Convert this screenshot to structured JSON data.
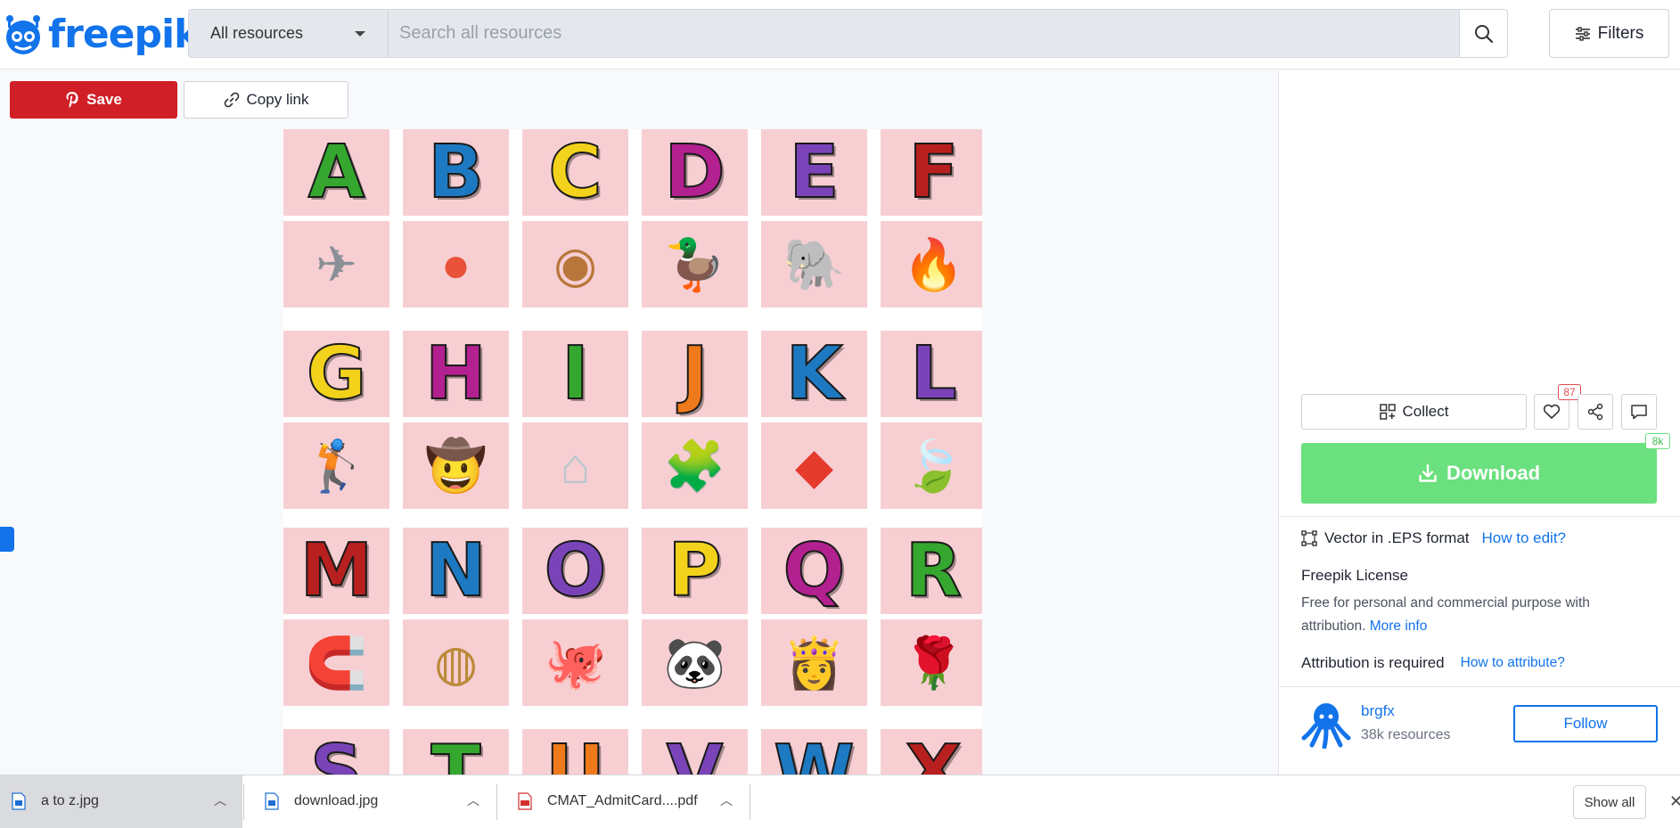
{
  "header": {
    "logo_text": "freepik",
    "resource_select": "All resources",
    "search_placeholder": "Search all resources",
    "filters_label": "Filters"
  },
  "actions": {
    "save_label": "Save",
    "copy_link_label": "Copy link"
  },
  "preview": {
    "background_color": "#f7cfd3",
    "rows": [
      {
        "letters": [
          "A",
          "B",
          "C",
          "D",
          "E",
          "F"
        ],
        "colors": [
          "#35a72f",
          "#1d7ac2",
          "#f2d21b",
          "#b3208f",
          "#7a44b8",
          "#b8201f"
        ],
        "pictures": [
          "airplane-icon",
          "beach-ball-icon",
          "cookie-icon",
          "duck-icon",
          "elephant-icon",
          "fire-icon"
        ]
      },
      {
        "letters": [
          "G",
          "H",
          "I",
          "J",
          "K",
          "L"
        ],
        "colors": [
          "#f2d21b",
          "#b3208f",
          "#35a72f",
          "#ee7a1b",
          "#1d7ac2",
          "#7a44b8"
        ],
        "pictures": [
          "golfer-icon",
          "hat-icon",
          "igloo-icon",
          "jigsaw-icon",
          "kite-icon",
          "leaf-icon"
        ]
      },
      {
        "letters": [
          "M",
          "N",
          "O",
          "P",
          "Q",
          "R"
        ],
        "colors": [
          "#b8201f",
          "#1d7ac2",
          "#7a44b8",
          "#f2d21b",
          "#b3208f",
          "#35a72f"
        ],
        "pictures": [
          "magnet-icon",
          "nest-icon",
          "octopus-icon",
          "panda-icon",
          "princess-icon",
          "rose-icon"
        ]
      },
      {
        "letters": [
          "S",
          "T",
          "U",
          "V",
          "W",
          "X"
        ],
        "colors": [
          "#7a44b8",
          "#35a72f",
          "#ee7a1b",
          "#7a44b8",
          "#1d7ac2",
          "#b8201f"
        ],
        "pictures": []
      }
    ]
  },
  "panel": {
    "collect_label": "Collect",
    "likes_count": "87",
    "downloads_badge": "8k",
    "download_label": "Download",
    "format_text": "Vector in .EPS format",
    "how_to_edit": "How to edit?",
    "license_title": "Freepik License",
    "license_text": "Free for personal and commercial purpose with attribution.",
    "more_info": "More info",
    "attribution_text": "Attribution is required",
    "how_to_attribute": "How to attribute?",
    "author_name": "brgfx",
    "author_resources": "38k resources",
    "follow_label": "Follow"
  },
  "downloads_bar": {
    "items": [
      {
        "name": "a to z.jpg",
        "type": "image"
      },
      {
        "name": "download.jpg",
        "type": "image"
      },
      {
        "name": "CMAT_AdmitCard....pdf",
        "type": "pdf"
      }
    ],
    "show_all": "Show all"
  },
  "colors": {
    "brand_blue": "#1273eb",
    "save_red": "#d11f27",
    "download_green": "#6be07e"
  }
}
